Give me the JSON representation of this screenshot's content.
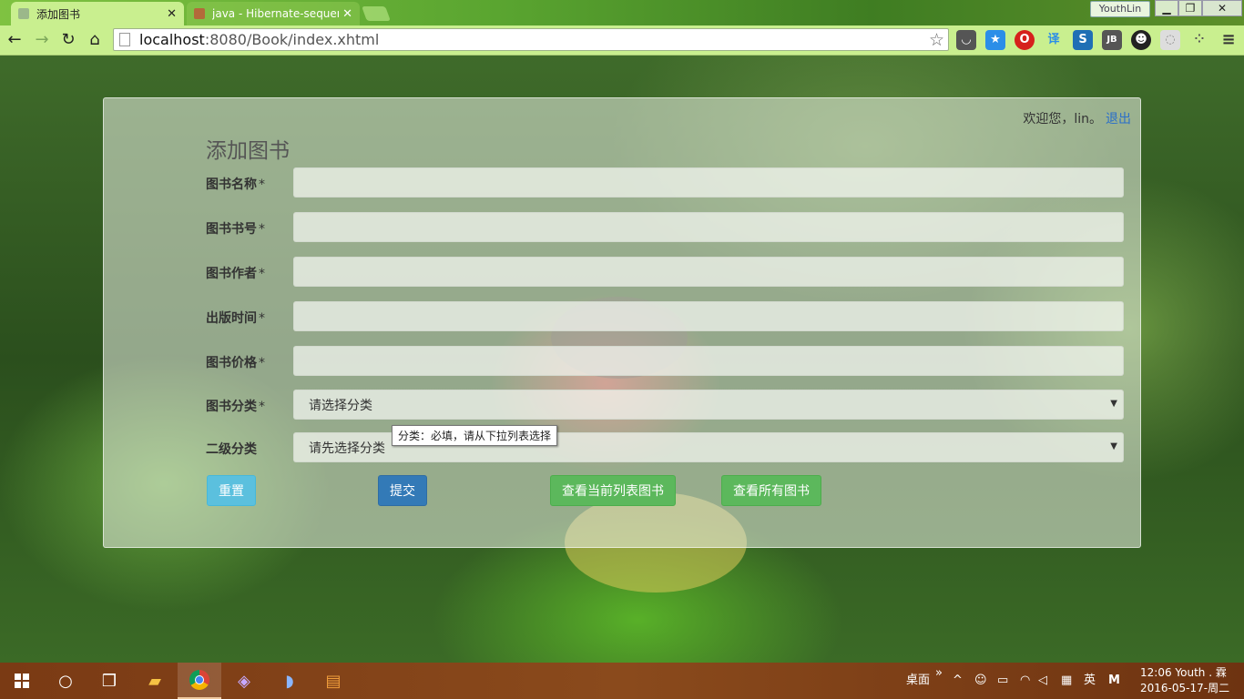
{
  "browser": {
    "tabs": [
      {
        "label": "添加图书",
        "active": true
      },
      {
        "label": "java - Hibernate-sequen",
        "active": false
      }
    ],
    "profile_name": "YouthLin",
    "url_host": "localhost",
    "url_path": ":8080/Book/index.xhtml",
    "extensions": [
      "pocket-icon",
      "bookmark-star-icon",
      "opera-icon",
      "translate-icon",
      "s-icon",
      "jb-icon",
      "avatar-icon",
      "cloud-icon",
      "more-icon"
    ],
    "ext_translate_label": "译",
    "ext_s_label": "S",
    "ext_jb_label": "JB"
  },
  "page": {
    "welcome_text": "欢迎您，lin。",
    "logout_label": "退出",
    "form_title": "添加图书",
    "fields": [
      {
        "label": "图书名称",
        "required": "*",
        "type": "text",
        "value": ""
      },
      {
        "label": "图书书号",
        "required": "*",
        "type": "text",
        "value": ""
      },
      {
        "label": "图书作者",
        "required": "*",
        "type": "text",
        "value": ""
      },
      {
        "label": "出版时间",
        "required": "*",
        "type": "text",
        "value": ""
      },
      {
        "label": "图书价格",
        "required": "*",
        "type": "text",
        "value": ""
      },
      {
        "label": "图书分类",
        "required": "*",
        "type": "select",
        "value": "请选择分类"
      },
      {
        "label": "二级分类",
        "required": "",
        "type": "select",
        "value": "请先选择分类"
      }
    ],
    "tooltip": "分类：必填，请从下拉列表选择",
    "buttons": {
      "reset": "重置",
      "submit": "提交",
      "view_current": "查看当前列表图书",
      "view_all": "查看所有图书"
    }
  },
  "taskbar": {
    "desktop_label": "桌面",
    "ime_label": "英",
    "clock_time": "12:06 Youth . 霖",
    "clock_date": "2016-05-17-周二"
  }
}
